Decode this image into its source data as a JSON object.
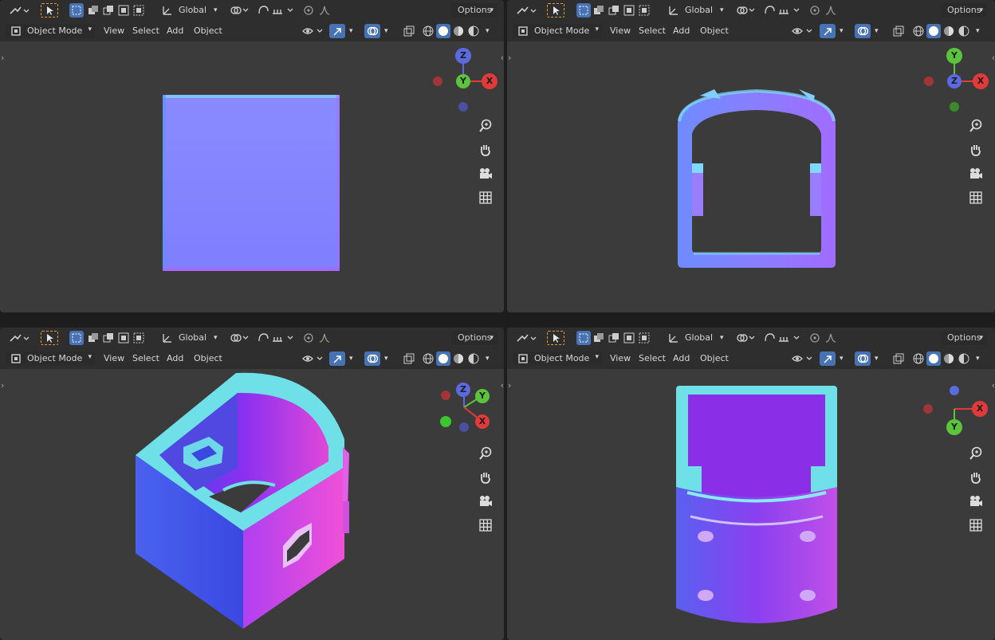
{
  "colors": {
    "viewport_bg": "#3b3b3b",
    "header_bg": "#2e2e2e",
    "active_blue": "#4772b3",
    "select_orange": "#e89a2c",
    "axis_x": "#e03a3a",
    "axis_y": "#5cc33c",
    "axis_z": "#5c6ae0"
  },
  "header": {
    "transform_orientation": "Global",
    "options_label": "Options",
    "mode_label": "Object Mode",
    "menu": {
      "view": "View",
      "select": "Select",
      "add": "Add",
      "object": "Object"
    }
  },
  "viewports": [
    {
      "view": "front-orthographic",
      "gizmo": {
        "top": "Z",
        "center": "Y",
        "right": "X"
      }
    },
    {
      "view": "top-orthographic",
      "gizmo": {
        "top": "Y",
        "center": "Z",
        "right": "X"
      }
    },
    {
      "view": "user-perspective",
      "gizmo": {
        "top": "Z",
        "center": "Y",
        "right": "X"
      }
    },
    {
      "view": "bottom-orthographic",
      "gizmo": {
        "right": "X",
        "bottom": "Y"
      }
    }
  ],
  "nav_icons": [
    "zoom-icon",
    "pan-hand-icon",
    "camera-icon",
    "grid-icon"
  ]
}
